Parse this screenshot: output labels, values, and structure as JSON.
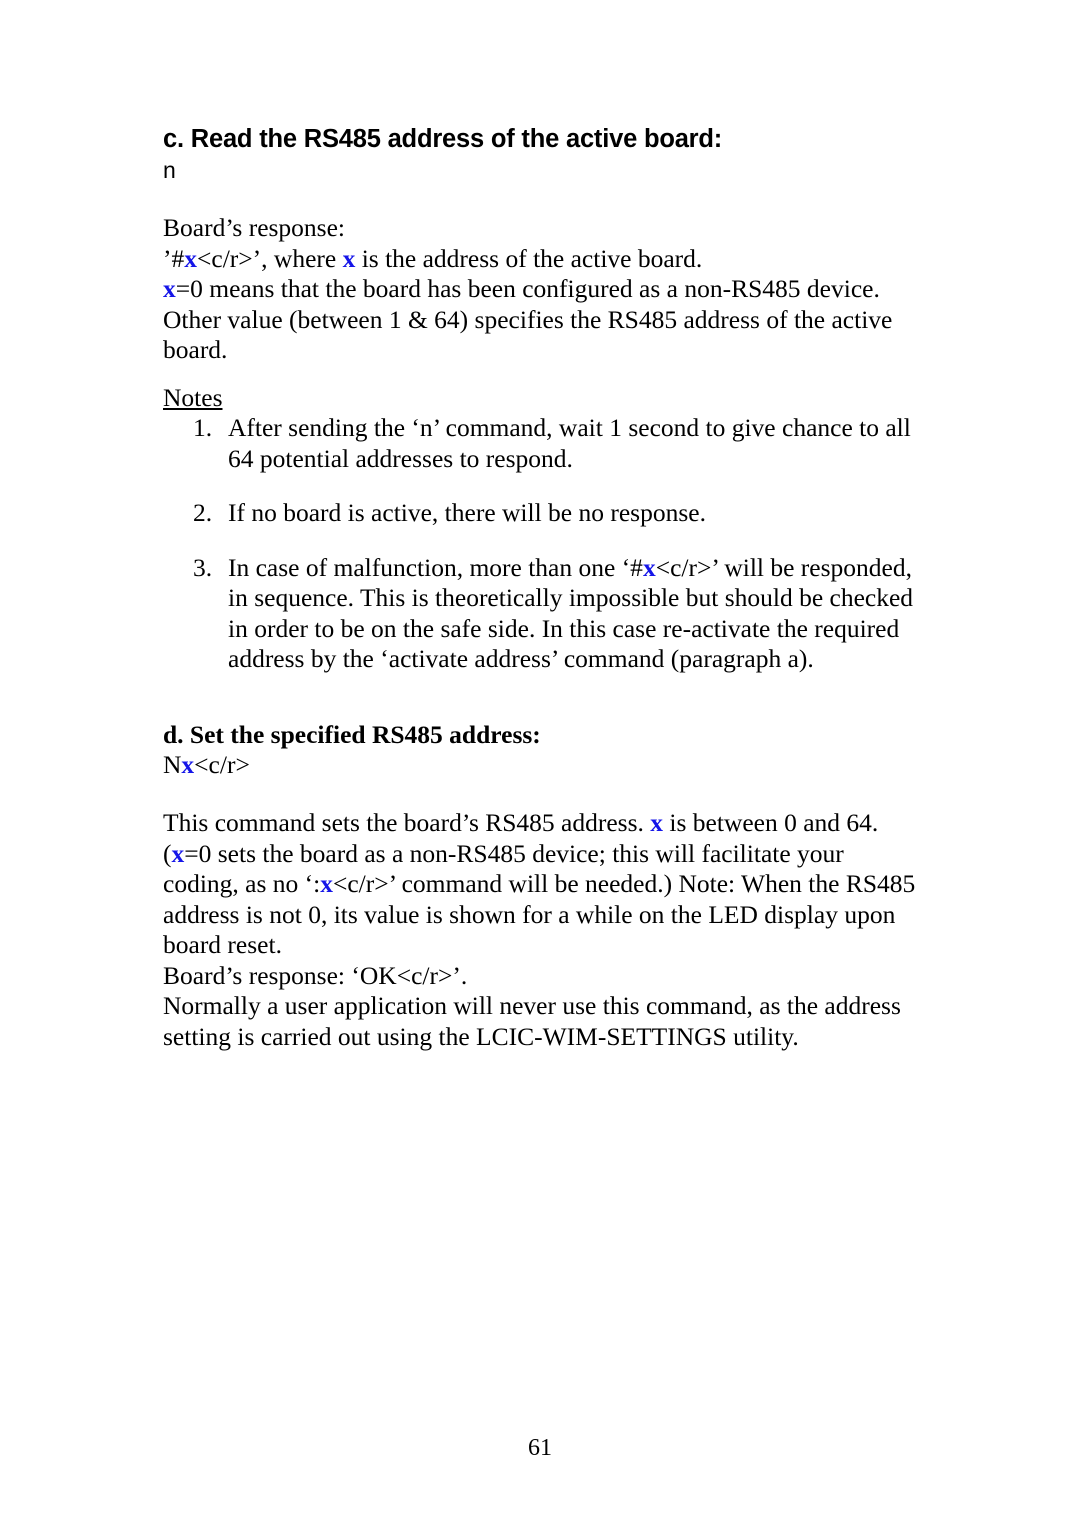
{
  "page": {
    "number": "61",
    "background_color": "#ffffff",
    "text_color": "#000000",
    "variable_color": "#1515e8"
  },
  "section_c": {
    "heading": "c. Read the RS485 address of the active board:",
    "command": "n",
    "response_label": "Board’s response:",
    "response_line_prefix": "’#",
    "response_var": "x",
    "response_line_mid": "<c/r>’, where ",
    "response_var2": "x",
    "response_line_suffix": " is the address of the active board.",
    "zero_line_var": "x",
    "zero_line_text": "=0 means that the board has been configured as a non-RS485 device.",
    "other_value_text": "Other value (between 1 & 64) specifies the RS485 address of the active board.",
    "notes_label": "Notes",
    "notes": [
      {
        "number": "1.",
        "text": "After sending the ‘n’ command, wait 1 second to give chance to all 64 potential addresses to respond."
      },
      {
        "number": "2.",
        "text": "If no board is active, there will be no response."
      },
      {
        "number": "3.",
        "text_before": "In case of malfunction, more than one ‘#",
        "var": "x",
        "text_after": "<c/r>’ will be responded, in sequence. This is theoretically impossible but should be checked in order to be on the safe side. In this case re-activate the required address by the ‘activate address’ command (paragraph a)."
      }
    ]
  },
  "section_d": {
    "heading": "d. Set the specified RS485 address:",
    "command_prefix": "N",
    "command_var": "x",
    "command_suffix": "<c/r>",
    "body_1_before": "This command sets the board’s RS485 address. ",
    "body_1_var": "x",
    "body_1_after": " is between 0 and 64. (",
    "body_2_var": "x",
    "body_2_after": "=0 sets the board as a non-RS485 device; this will facilitate your coding, as no  ‘:",
    "body_3_var": "x",
    "body_3_after": "<c/r>’ command will be needed.) Note: When the RS485 address is not 0, its value is shown for a while on the LED display upon board reset.",
    "response_line": "Board’s response: ‘OK<c/r>’.",
    "closing_text": "Normally a user application will never use this command, as the address setting is carried out using the LCIC-WIM-SETTINGS utility."
  }
}
